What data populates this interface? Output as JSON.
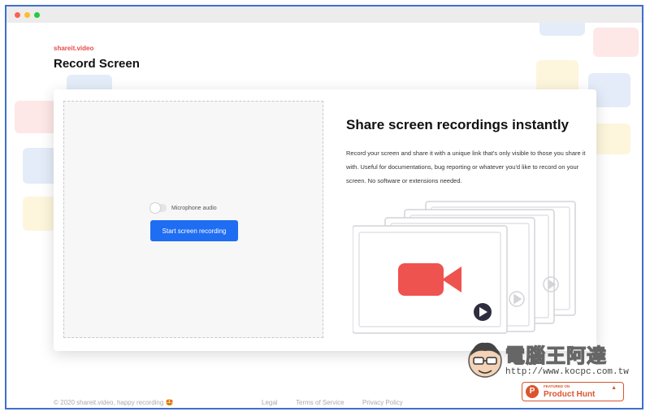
{
  "window": {
    "controls": [
      "close",
      "minimize",
      "zoom"
    ]
  },
  "brand": "shareit.video",
  "page_title": "Record Screen",
  "recorder": {
    "toggle_label": "Microphone audio",
    "toggle_on": false,
    "start_button": "Start screen recording"
  },
  "info": {
    "headline": "Share screen recordings instantly",
    "description": "Record your screen and share it with a unique link that's only visible to those you share it with. Useful for documentations, bug reporting or whatever you'd like to record on your screen. No software or extensions needed."
  },
  "illustration": {
    "icons": [
      "video-camera-icon",
      "play-icon"
    ]
  },
  "footer": {
    "copyright": "© 2020 shareit.video, happy recording 🤩",
    "links": [
      "Legal",
      "Terms of Service",
      "Privacy Policy"
    ]
  },
  "product_hunt": {
    "kicker": "FEATURED ON",
    "name": "Product Hunt"
  },
  "watermark": {
    "text": "電腦王阿達",
    "url": "http://www.kocpc.com.tw"
  },
  "colors": {
    "accent": "#1f6df2",
    "brand": "#e8494b",
    "camera": "#ef5350",
    "window_border": "#3d6fcf"
  }
}
